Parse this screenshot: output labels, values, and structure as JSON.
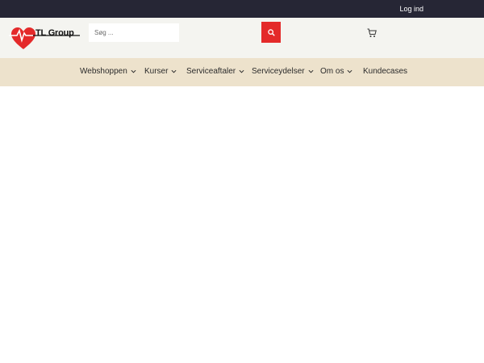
{
  "topbar": {
    "login_label": "Log ind"
  },
  "header": {
    "logo_text": "TL Group",
    "search_placeholder": "Søg ...",
    "search_value": "",
    "brand_color": "#e42a2a"
  },
  "nav": {
    "items": [
      {
        "label": "Webshoppen",
        "has_dropdown": true
      },
      {
        "label": "Kurser",
        "has_dropdown": true
      },
      {
        "label": "Serviceaftaler",
        "has_dropdown": true
      },
      {
        "label": "Serviceydelser",
        "has_dropdown": true
      },
      {
        "label": "Om os",
        "has_dropdown": true
      },
      {
        "label": "Kundecases",
        "has_dropdown": false
      }
    ]
  },
  "icons": {
    "search": "search-icon",
    "cart": "cart-icon",
    "dropdown": "chevron-down-icon"
  }
}
